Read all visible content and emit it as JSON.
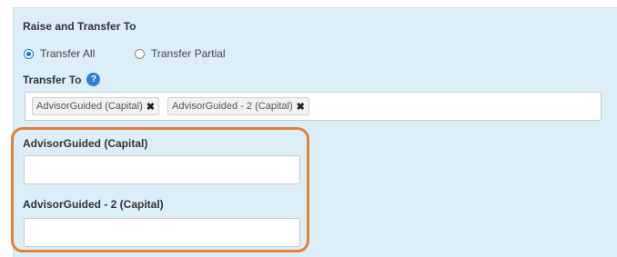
{
  "section": {
    "title": "Raise and Transfer To"
  },
  "transfer_mode": {
    "options": [
      {
        "label": "Transfer All",
        "selected": true
      },
      {
        "label": "Transfer Partial",
        "selected": false
      }
    ]
  },
  "transfer_to": {
    "label": "Transfer To",
    "help_glyph": "?",
    "tags": [
      {
        "label": "AdvisorGuided (Capital)",
        "remove_glyph": "✖"
      },
      {
        "label": "AdvisorGuided - 2 (Capital)",
        "remove_glyph": "✖"
      }
    ]
  },
  "fields": [
    {
      "label": "AdvisorGuided (Capital)",
      "value": ""
    },
    {
      "label": "AdvisorGuided - 2 (Capital)",
      "value": ""
    }
  ],
  "colors": {
    "panel_bg": "#dceef8",
    "accent": "#1b73d6",
    "highlight": "#e2803a"
  }
}
